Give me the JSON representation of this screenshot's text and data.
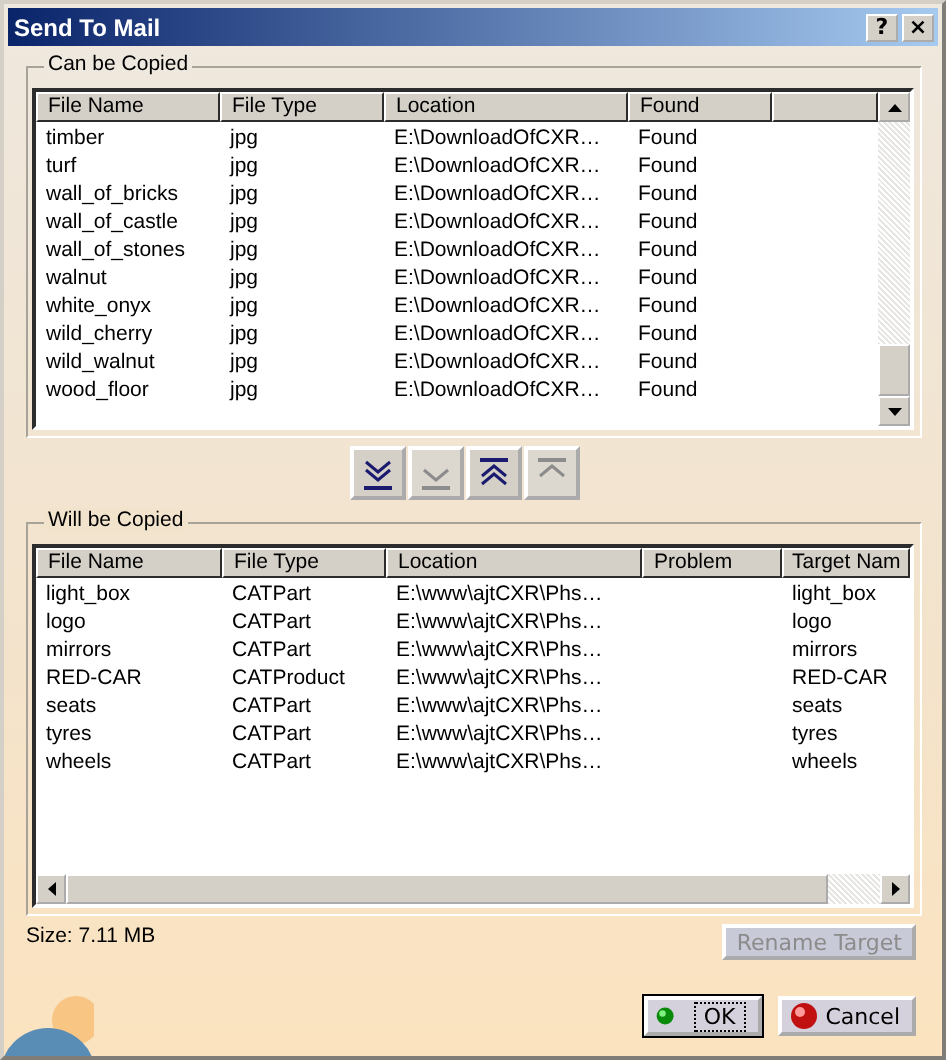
{
  "window": {
    "title": "Send To Mail",
    "buttons": [
      "?",
      "×"
    ]
  },
  "can_be_copied": {
    "title": "Can be Copied",
    "columns": [
      "File Name",
      "File Type",
      "Location",
      "Found"
    ],
    "rows": [
      [
        "timber",
        "jpg",
        "E:\\DownloadOfCXR…",
        "Found"
      ],
      [
        "turf",
        "jpg",
        "E:\\DownloadOfCXR…",
        "Found"
      ],
      [
        "wall_of_bricks",
        "jpg",
        "E:\\DownloadOfCXR…",
        "Found"
      ],
      [
        "wall_of_castle",
        "jpg",
        "E:\\DownloadOfCXR…",
        "Found"
      ],
      [
        "wall_of_stones",
        "jpg",
        "E:\\DownloadOfCXR…",
        "Found"
      ],
      [
        "walnut",
        "jpg",
        "E:\\DownloadOfCXR…",
        "Found"
      ],
      [
        "white_onyx",
        "jpg",
        "E:\\DownloadOfCXR…",
        "Found"
      ],
      [
        "wild_cherry",
        "jpg",
        "E:\\DownloadOfCXR…",
        "Found"
      ],
      [
        "wild_walnut",
        "jpg",
        "E:\\DownloadOfCXR…",
        "Found"
      ],
      [
        "wood_floor",
        "jpg",
        "E:\\DownloadOfCXR…",
        "Found"
      ]
    ]
  },
  "move_buttons": [
    {
      "kind": "all-down",
      "disabled": false
    },
    {
      "kind": "down",
      "disabled": true
    },
    {
      "kind": "all-up",
      "disabled": false
    },
    {
      "kind": "up",
      "disabled": true
    }
  ],
  "will_be_copied": {
    "title": "Will be Copied",
    "columns": [
      "File Name",
      "File Type",
      "Location",
      "Problem",
      "Target Nam"
    ],
    "rows": [
      [
        "light_box",
        "CATPart",
        "E:\\www\\ajtCXR\\Phs…",
        "",
        "light_box"
      ],
      [
        "logo",
        "CATPart",
        "E:\\www\\ajtCXR\\Phs…",
        "",
        "logo"
      ],
      [
        "mirrors",
        "CATPart",
        "E:\\www\\ajtCXR\\Phs…",
        "",
        "mirrors"
      ],
      [
        "RED-CAR",
        "CATProduct",
        "E:\\www\\ajtCXR\\Phs…",
        "",
        "RED-CAR"
      ],
      [
        "seats",
        "CATPart",
        "E:\\www\\ajtCXR\\Phs…",
        "",
        "seats"
      ],
      [
        "tyres",
        "CATPart",
        "E:\\www\\ajtCXR\\Phs…",
        "",
        "tyres"
      ],
      [
        "wheels",
        "CATPart",
        "E:\\www\\ajtCXR\\Phs…",
        "",
        "wheels"
      ]
    ]
  },
  "size": "Size: 7.11 MB",
  "rename_button": {
    "label": "Rename Target",
    "disabled": true
  },
  "buttons": [
    {
      "label": "OK",
      "kind": "ok",
      "default": true
    },
    {
      "label": "Cancel",
      "kind": "cancel",
      "default": false
    }
  ]
}
